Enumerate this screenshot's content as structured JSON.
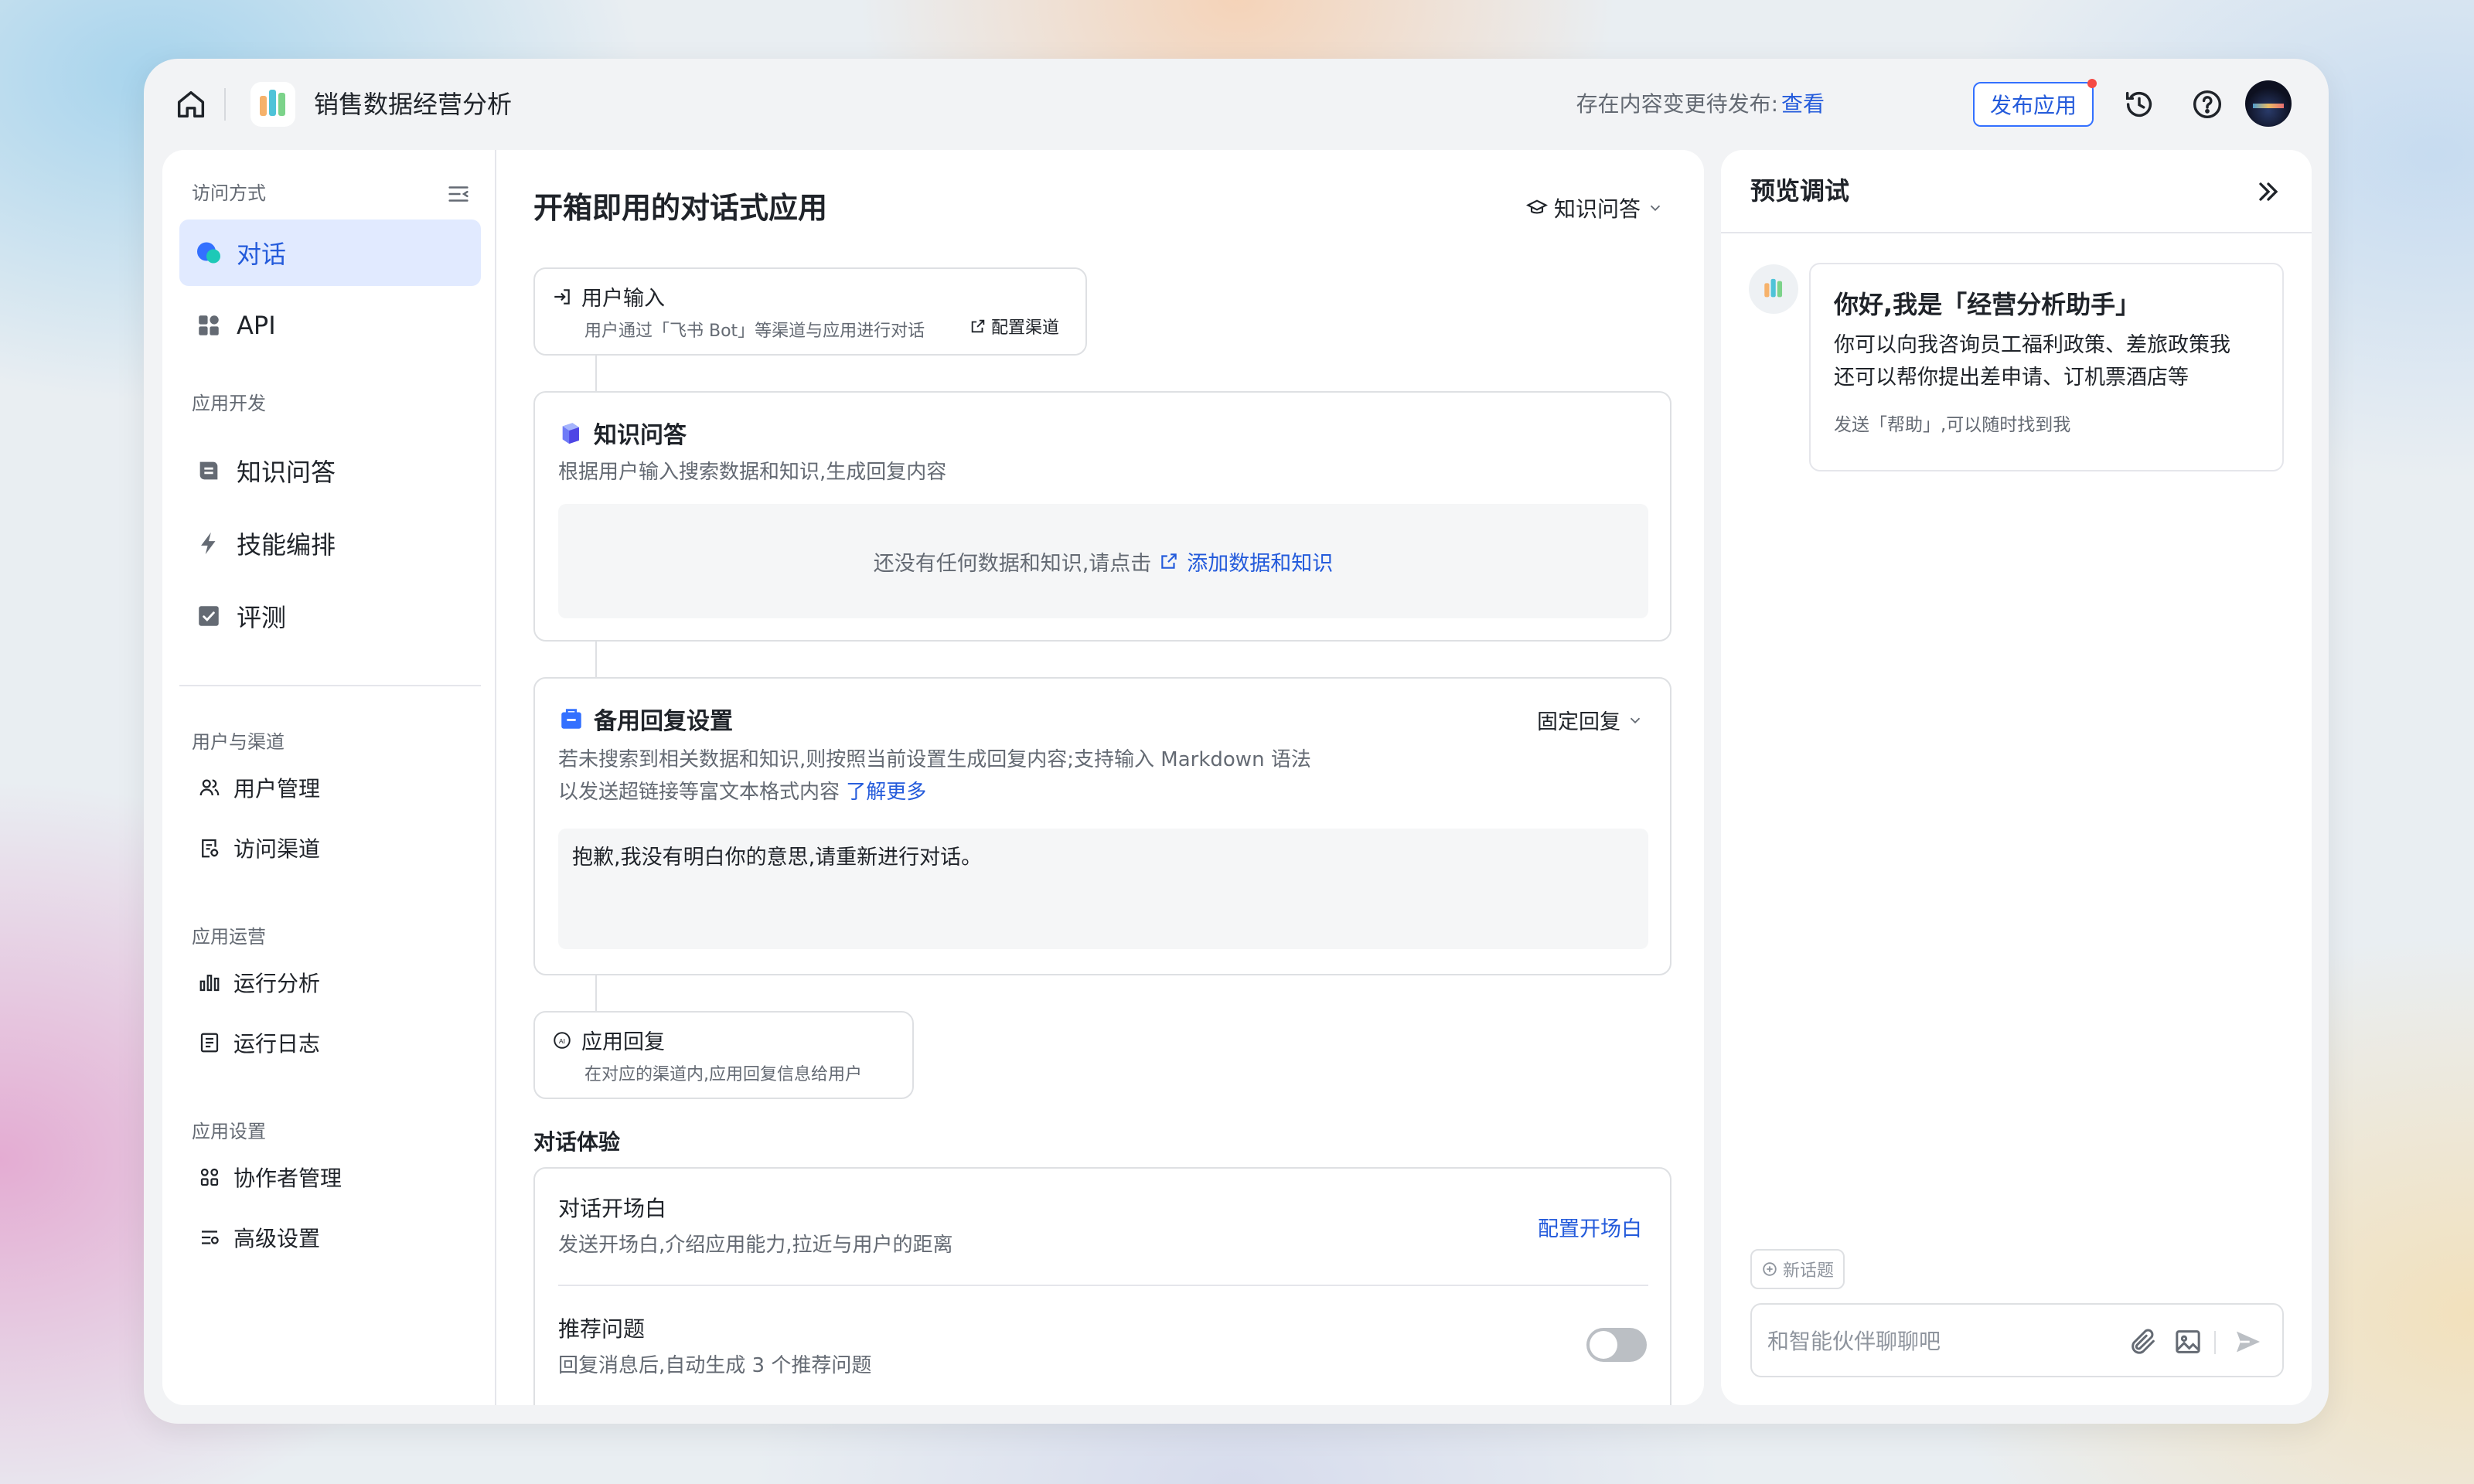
{
  "header": {
    "app_title": "销售数据经营分析",
    "pending_text": "存在内容变更待发布:",
    "pending_link": "查看",
    "publish_button": "发布应用"
  },
  "sidebar": {
    "access_section": "访问方式",
    "access_items": [
      {
        "label": "对话",
        "icon": "chat-bubble-icon",
        "active": true
      },
      {
        "label": "API",
        "icon": "grid-icon",
        "active": false
      }
    ],
    "dev_section": "应用开发",
    "dev_items": [
      {
        "label": "知识问答",
        "icon": "book-icon"
      },
      {
        "label": "技能编排",
        "icon": "lightning-icon"
      },
      {
        "label": "评测",
        "icon": "check-square-icon"
      }
    ],
    "users_section": "用户与渠道",
    "users_items": [
      {
        "label": "用户管理",
        "icon": "users-icon"
      },
      {
        "label": "访问渠道",
        "icon": "channel-icon"
      }
    ],
    "ops_section": "应用运营",
    "ops_items": [
      {
        "label": "运行分析",
        "icon": "bar-chart-icon"
      },
      {
        "label": "运行日志",
        "icon": "log-icon"
      }
    ],
    "settings_section": "应用设置",
    "settings_items": [
      {
        "label": "协作者管理",
        "icon": "collaborators-icon"
      },
      {
        "label": "高级设置",
        "icon": "settings-icon"
      }
    ]
  },
  "main": {
    "title": "开箱即用的对话式应用",
    "mode": "知识问答",
    "user_input": {
      "title": "用户输入",
      "desc": "用户通过「飞书 Bot」等渠道与应用进行对话",
      "link": "配置渠道"
    },
    "knowledge": {
      "title": "知识问答",
      "desc": "根据用户输入搜索数据和知识,生成回复内容",
      "empty_text": "还没有任何数据和知识,请点击",
      "empty_link": "添加数据和知识"
    },
    "fallback": {
      "title": "备用回复设置",
      "mode": "固定回复",
      "desc_line1": "若未搜索到相关数据和知识,则按照当前设置生成回复内容;支持输入 Markdown 语法",
      "desc_line2": "以发送超链接等富文本格式内容",
      "learn_more": "了解更多",
      "content": "抱歉,我没有明白你的意思,请重新进行对话。"
    },
    "app_reply": {
      "title": "应用回复",
      "desc": "在对应的渠道内,应用回复信息给用户"
    },
    "experience": {
      "section": "对话体验",
      "opening_title": "对话开场白",
      "opening_desc": "发送开场白,介绍应用能力,拉近与用户的距离",
      "opening_link": "配置开场白",
      "suggest_title": "推荐问题",
      "suggest_desc": "回复消息后,自动生成 3 个推荐问题",
      "suggest_enabled": false
    }
  },
  "preview": {
    "title": "预览调试",
    "greeting_title": "你好,我是「经营分析助手」",
    "greeting_line1": "你可以向我咨询员工福利政策、差旅政策我",
    "greeting_line2": "还可以帮你提出差申请、订机票酒店等",
    "greeting_hint": "发送「帮助」,可以随时找到我",
    "new_topic": "新话题",
    "input_placeholder": "和智能伙伴聊聊吧"
  },
  "colors": {
    "accent": "#3370ff",
    "accent_text": "#245bdb",
    "active_bg": "#e1eaff",
    "notification_dot": "#f54a45"
  }
}
